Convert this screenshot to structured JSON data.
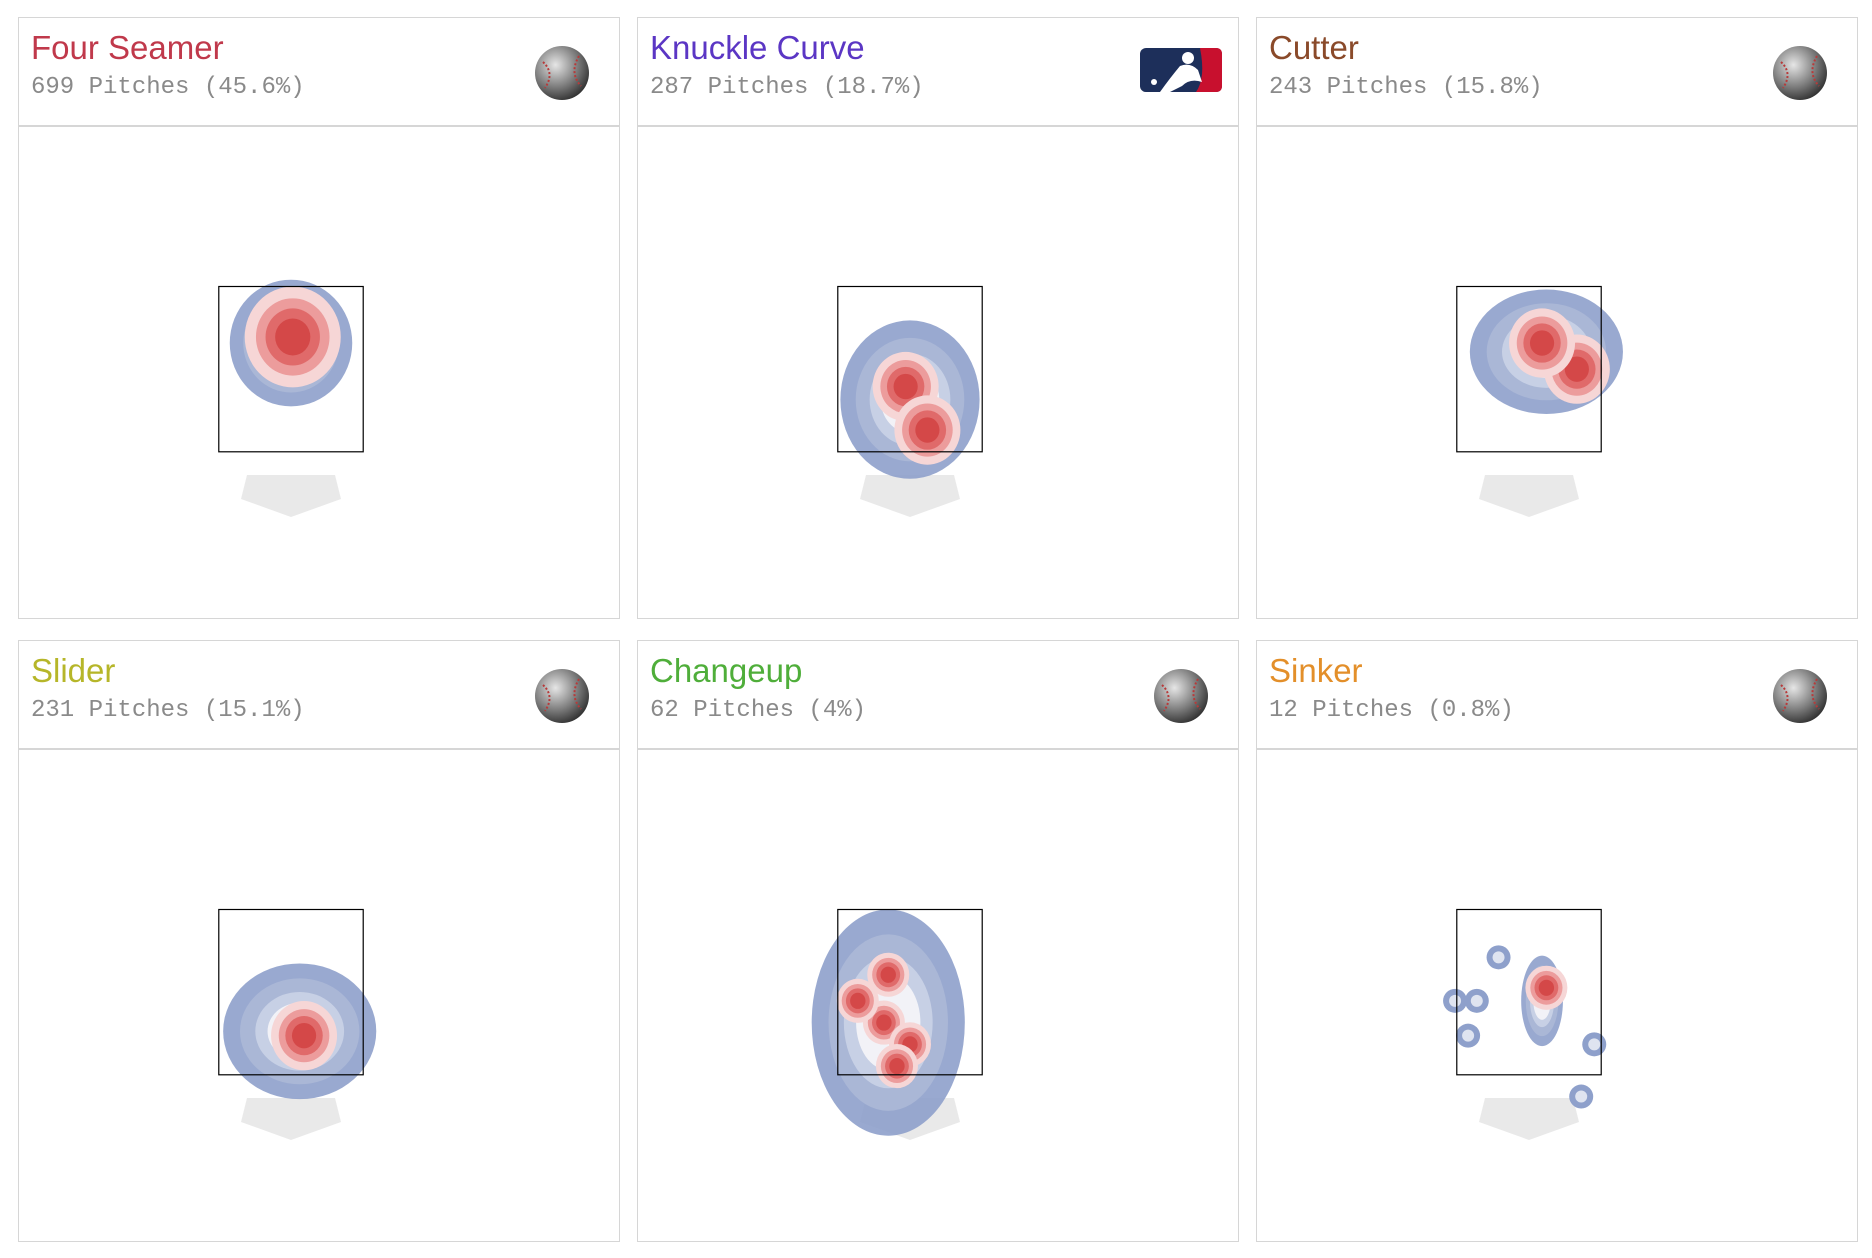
{
  "chart_data": {
    "type": "heatmap",
    "panels": [
      {
        "pitch": "Four Seamer",
        "count_label": "699 Pitches (45.6%)",
        "pitches": 699,
        "percent": 45.6,
        "color": "#c0394b",
        "icon": "baseball-icon",
        "hot_spots": [
          {
            "x": 0.02,
            "y": 2.92
          }
        ],
        "blobs": [
          {
            "x": 0.0,
            "y": 2.85,
            "w": 0.44,
            "h": 0.56
          }
        ]
      },
      {
        "pitch": "Knuckle Curve",
        "count_label": "287 Pitches (18.7%)",
        "pitches": 287,
        "percent": 18.7,
        "color": "#5b36c4",
        "icon": "mlb-logo-icon",
        "hot_spots": [
          {
            "x": -0.05,
            "y": 2.35
          },
          {
            "x": 0.2,
            "y": 1.85
          }
        ],
        "blobs": [
          {
            "x": 0.0,
            "y": 2.2,
            "w": 0.5,
            "h": 0.7
          }
        ]
      },
      {
        "pitch": "Cutter",
        "count_label": "243 Pitches (15.8%)",
        "pitches": 243,
        "percent": 15.8,
        "color": "#8a4a2a",
        "icon": "baseball-icon",
        "hot_spots": [
          {
            "x": 0.55,
            "y": 2.55
          },
          {
            "x": 0.15,
            "y": 2.85
          }
        ],
        "blobs": [
          {
            "x": 0.2,
            "y": 2.75,
            "w": 0.55,
            "h": 0.55
          }
        ]
      },
      {
        "pitch": "Slider",
        "count_label": "231 Pitches (15.1%)",
        "pitches": 231,
        "percent": 15.1,
        "color": "#b6b629",
        "icon": "baseball-icon",
        "hot_spots": [
          {
            "x": 0.15,
            "y": 2.05
          }
        ],
        "blobs": [
          {
            "x": 0.1,
            "y": 2.1,
            "w": 0.55,
            "h": 0.6
          }
        ]
      },
      {
        "pitch": "Changeup",
        "count_label": "62 Pitches (4%)",
        "pitches": 62,
        "percent": 4.0,
        "color": "#4fae3a",
        "icon": "baseball-icon",
        "hot_spots": [
          {
            "x": -0.25,
            "y": 2.75
          },
          {
            "x": -0.3,
            "y": 2.2
          },
          {
            "x": 0.0,
            "y": 1.95
          },
          {
            "x": -0.6,
            "y": 2.45
          },
          {
            "x": -0.15,
            "y": 1.7
          }
        ],
        "blobs": [
          {
            "x": -0.25,
            "y": 2.2,
            "w": 0.55,
            "h": 1.0
          }
        ]
      },
      {
        "pitch": "Sinker",
        "count_label": "12 Pitches (0.8%)",
        "pitches": 12,
        "percent": 0.8,
        "color": "#e38f2a",
        "icon": "baseball-icon",
        "hot_spots": [
          {
            "x": 0.2,
            "y": 2.6
          }
        ],
        "blobs": [
          {
            "x": 0.15,
            "y": 2.45,
            "w": 0.15,
            "h": 0.4
          }
        ],
        "points": [
          {
            "x": -0.35,
            "y": 2.95
          },
          {
            "x": -0.6,
            "y": 2.45
          },
          {
            "x": -0.85,
            "y": 2.45
          },
          {
            "x": -0.7,
            "y": 2.05
          },
          {
            "x": 0.75,
            "y": 1.95
          },
          {
            "x": 0.6,
            "y": 1.35
          }
        ]
      }
    ]
  },
  "colors": {
    "low": "#8ea0cb",
    "mid": "#ffffff",
    "high": "#d44848",
    "plate": "#e9e9e9",
    "zone": "#000000"
  }
}
